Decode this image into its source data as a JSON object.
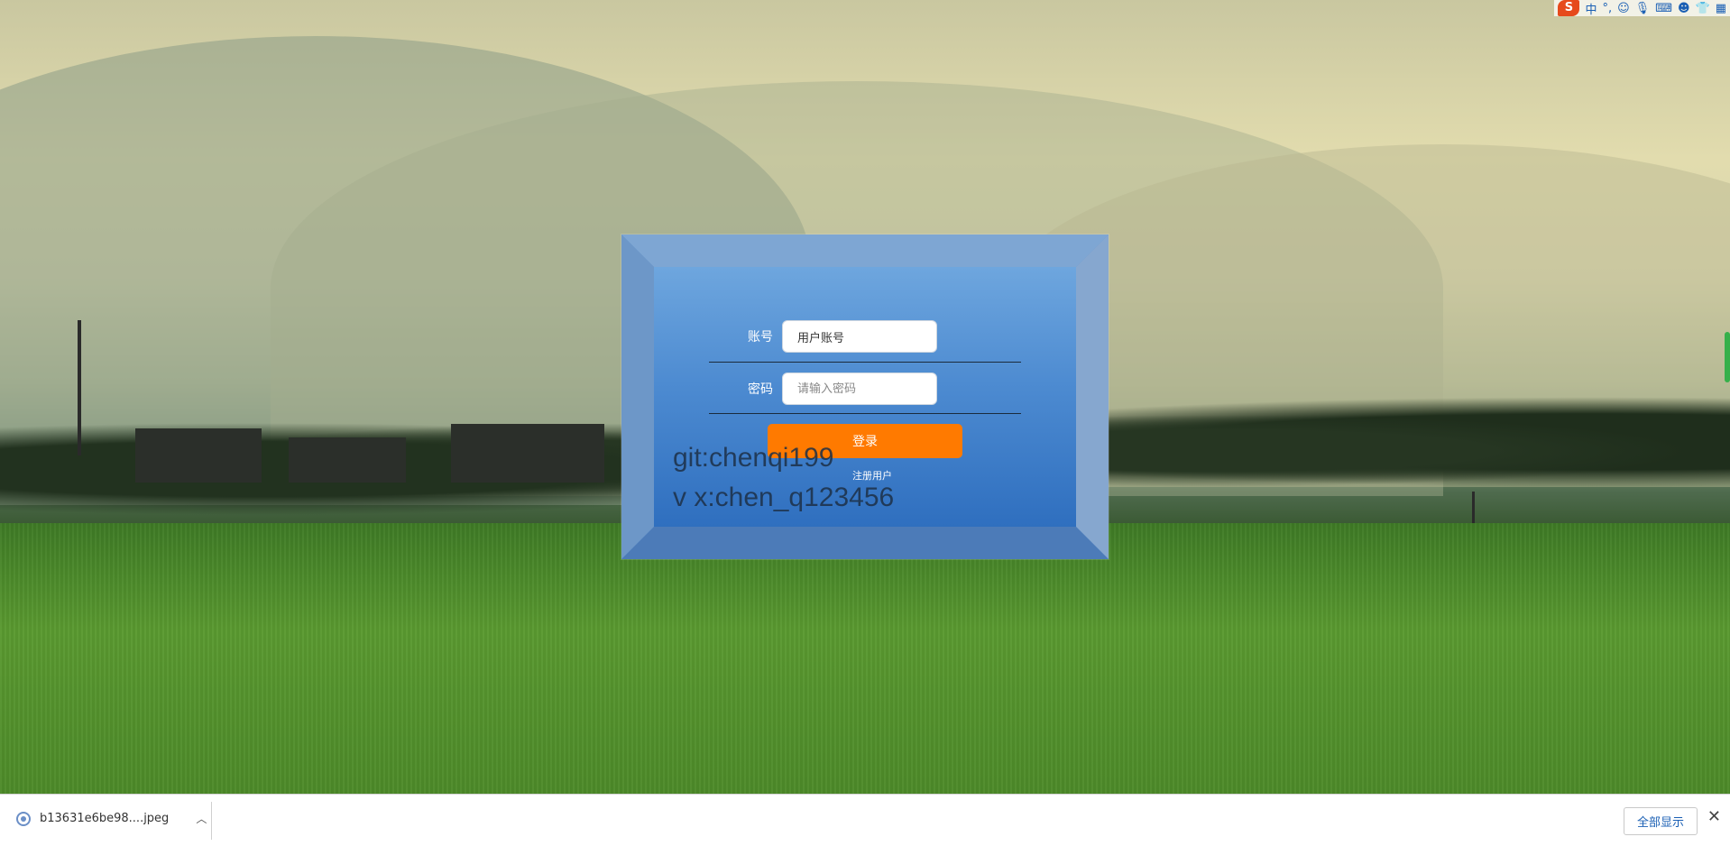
{
  "login": {
    "account_label": "账号",
    "account_value": "用户账号",
    "password_label": "密码",
    "password_placeholder": "请输入密码",
    "login_button": "登录",
    "register_link": "注册用户"
  },
  "watermark": {
    "line1": "git:chenqi199",
    "line2": "v x:chen_q123456"
  },
  "tray": {
    "logo": "S",
    "lang": "中",
    "punct": "°,",
    "icons": [
      "smiley-icon",
      "microphone-icon",
      "keyboard-icon",
      "user-icon",
      "shirt-icon",
      "grid-icon"
    ]
  },
  "download_bar": {
    "filename": "b13631e6be98....jpeg",
    "show_all": "全部显示",
    "close": "✕"
  },
  "colors": {
    "login_button": "#ff7a00",
    "panel": "#5c8fd0"
  }
}
